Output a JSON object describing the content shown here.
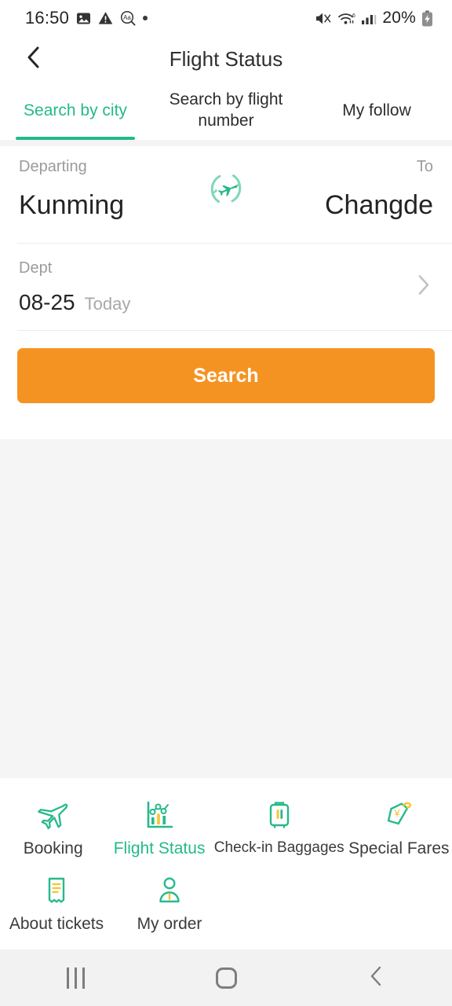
{
  "status_bar": {
    "time": "16:50",
    "battery_percent": "20%",
    "left_icons": [
      "image-icon",
      "warning-icon",
      "translate-search-icon",
      "dot-icon"
    ],
    "right_icons": [
      "mute-icon",
      "wifi-icon",
      "signal-icon",
      "battery-charging-icon"
    ]
  },
  "header": {
    "title": "Flight Status",
    "back_icon": "chevron-left-icon"
  },
  "tabs": [
    {
      "label": "Search by city",
      "active": true
    },
    {
      "label": "Search by flight number",
      "active": false
    },
    {
      "label": "My follow",
      "active": false
    }
  ],
  "search_form": {
    "departing_caption": "Departing",
    "departing_city": "Kunming",
    "to_caption": "To",
    "to_city": "Changde",
    "swap_icon": "swap-route-plane-icon",
    "date_caption": "Dept",
    "date_value": "08-25",
    "date_note": "Today",
    "date_chevron": "chevron-right-icon",
    "search_label": "Search"
  },
  "features": [
    {
      "label": "Booking",
      "icon": "airplane-icon",
      "active": false
    },
    {
      "label": "Flight Status",
      "icon": "bar-chart-icon",
      "active": true
    },
    {
      "label": "Check-in Baggages",
      "icon": "suitcase-icon",
      "active": false,
      "small": true
    },
    {
      "label": "Special Fares",
      "icon": "price-tag-yen-icon",
      "active": false
    },
    {
      "label": "About tickets",
      "icon": "receipt-icon",
      "active": false
    },
    {
      "label": "My order",
      "icon": "person-icon",
      "active": false
    }
  ],
  "android_nav": {
    "recents": "recents-icon",
    "home": "home-icon",
    "back": "back-icon"
  },
  "colors": {
    "green_accent": "#23b98b",
    "green_light": "#7fd8b6",
    "orange_button": "#f59322",
    "yellow_accent": "#f5c430",
    "gray_background": "#f5f5f5"
  }
}
